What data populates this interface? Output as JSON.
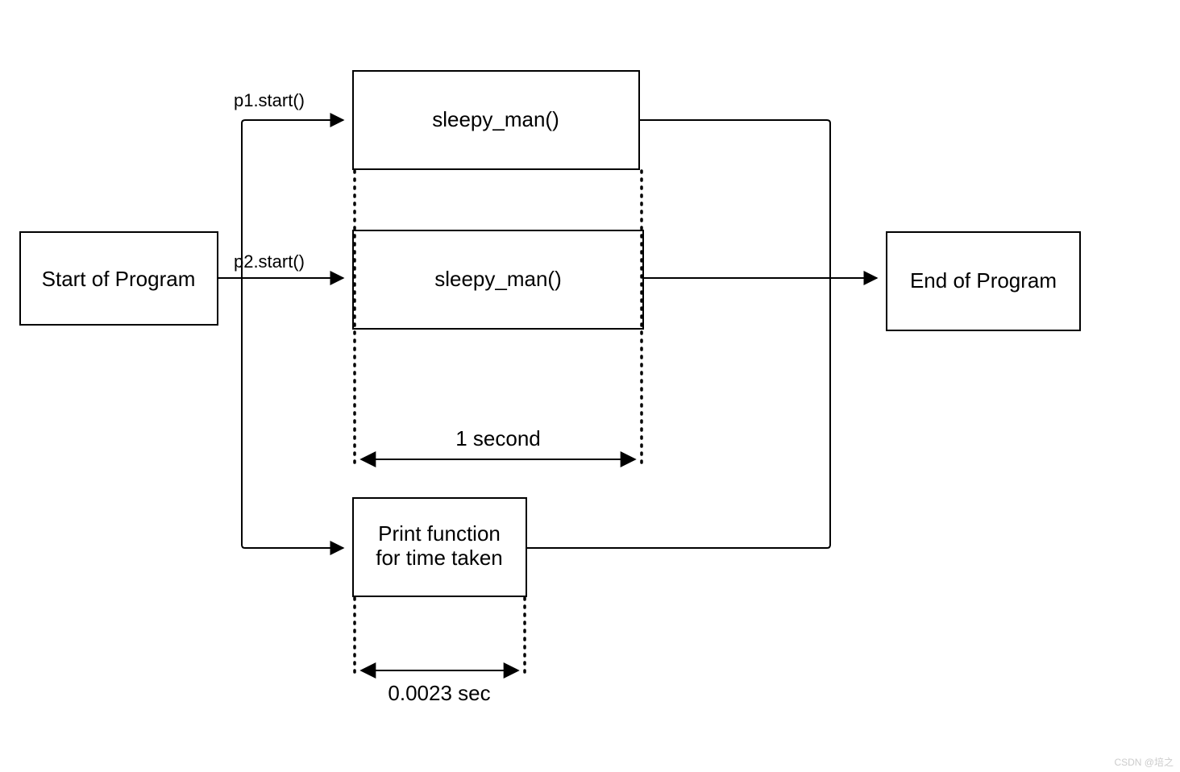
{
  "boxes": {
    "start": {
      "label": "Start of Program"
    },
    "sleepy1": {
      "label": "sleepy_man()"
    },
    "sleepy2": {
      "label": "sleepy_man()"
    },
    "print": {
      "line1": "Print function",
      "line2": "for time taken"
    },
    "end": {
      "label": "End of Program"
    }
  },
  "edges": {
    "p1_label": "p1.start()",
    "p2_label": "p2.start()"
  },
  "dims": {
    "one_second": "1 second",
    "short": "0.0023 sec"
  },
  "watermark": "CSDN @培之"
}
